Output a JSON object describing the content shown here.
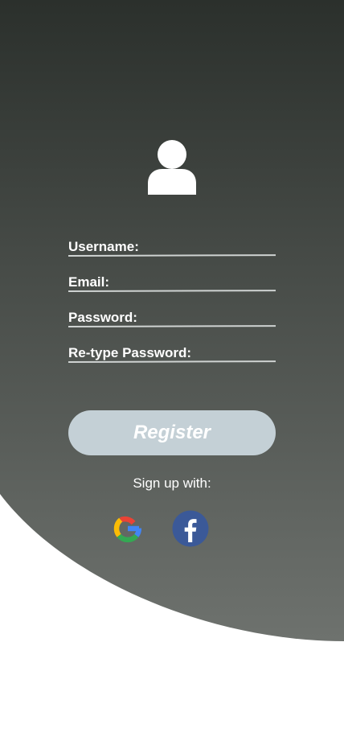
{
  "form": {
    "fields": [
      {
        "label": "Username:",
        "value": ""
      },
      {
        "label": "Email:",
        "value": ""
      },
      {
        "label": "Password:",
        "value": ""
      },
      {
        "label": "Re-type Password:",
        "value": ""
      }
    ]
  },
  "actions": {
    "register_label": "Register",
    "signup_text": "Sign up with:"
  },
  "social": [
    {
      "name": "google",
      "icon": "google-icon"
    },
    {
      "name": "facebook",
      "icon": "facebook-icon"
    }
  ],
  "colors": {
    "background_top": "#2b302c",
    "background_bottom": "#6d716d",
    "register_button": "#c4d0d6",
    "facebook_blue": "#3b5998",
    "page": "#ffffff"
  }
}
